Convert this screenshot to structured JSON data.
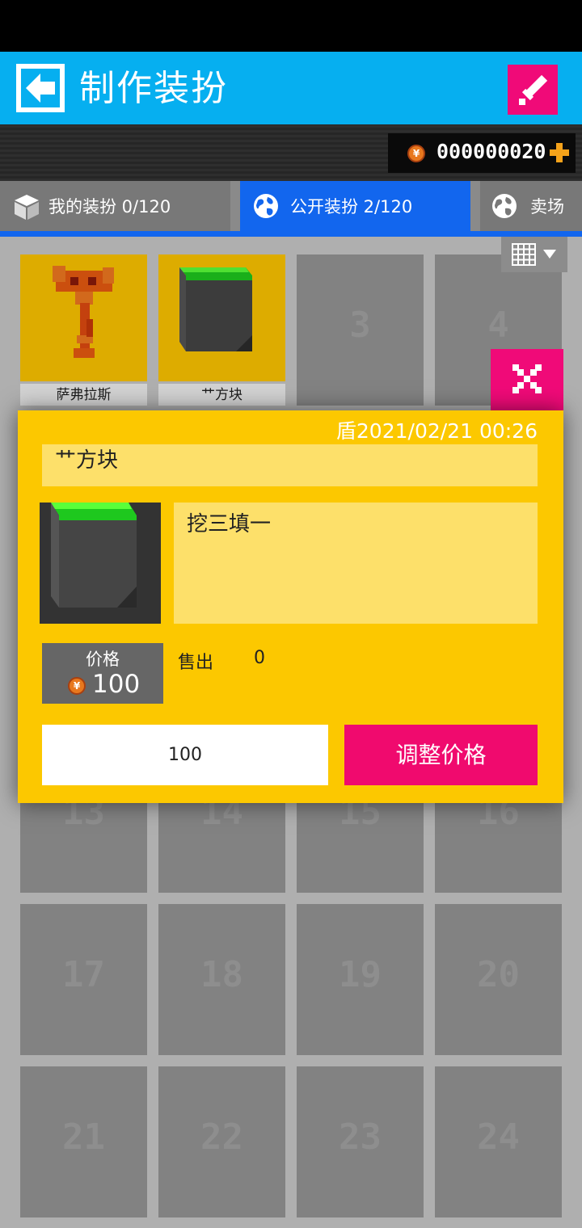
{
  "header": {
    "title": "制作装扮"
  },
  "wallet": {
    "coins": "000000020"
  },
  "tabs": [
    {
      "label": "我的装扮 0/120",
      "active": false
    },
    {
      "label": "公开装扮 2/120",
      "active": true
    },
    {
      "label": "卖场",
      "active": false
    }
  ],
  "grid": {
    "items": [
      {
        "name": "萨弗拉斯"
      },
      {
        "name": "艹方块"
      }
    ],
    "empty_slots": [
      "3",
      "4",
      "13",
      "14",
      "15",
      "16",
      "17",
      "18",
      "19",
      "20",
      "21",
      "22",
      "23",
      "24"
    ]
  },
  "dialog": {
    "date": "盾2021/02/21 00:26",
    "name": "艹方块",
    "description": "挖三填一",
    "price_label": "价格",
    "price_value": "100",
    "sold_label": "售出",
    "sold_value": "0",
    "price_input": "100",
    "adjust_button": "调整价格"
  },
  "icons": {
    "back": "back-arrow-icon",
    "edit": "sword-icon",
    "coin": "coin-icon",
    "add": "plus-icon",
    "my_tab": "cube-icon",
    "public_tab": "globe-icon",
    "market_tab": "globe-icon",
    "view": "grid-view-icon",
    "close": "close-icon"
  },
  "colors": {
    "header": "#06aff0",
    "accent": "#f00a78",
    "tab_active": "#1266ee",
    "card": "#fcc400"
  }
}
